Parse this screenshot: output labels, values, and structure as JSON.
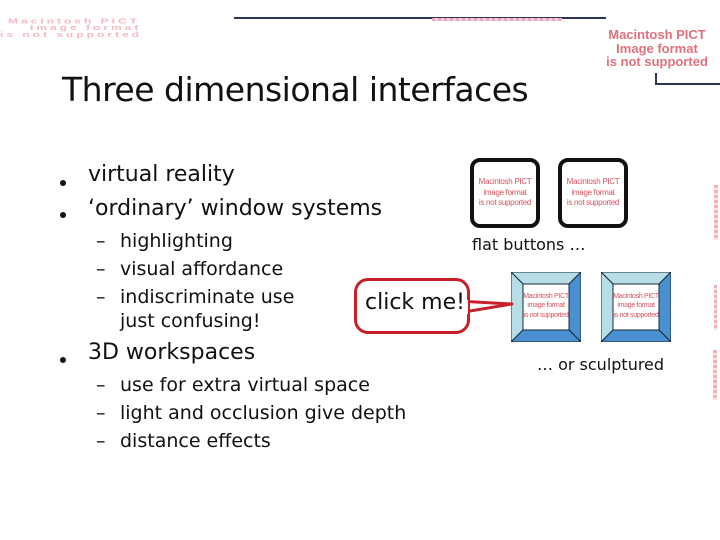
{
  "slide": {
    "title": "Three dimensional interfaces",
    "bullets": [
      {
        "text": "virtual reality"
      },
      {
        "text": "‘ordinary’ window systems",
        "subitems": [
          "highlighting",
          "visual affordance",
          "indiscriminate use",
          "just confusing!"
        ]
      },
      {
        "text": "3D workspaces",
        "subitems": [
          "use for extra virtual space",
          "light and occlusion give depth",
          "distance effects"
        ]
      }
    ],
    "dash": "–",
    "callout_text": "click me!",
    "flat_caption": "flat buttons …",
    "sculpt_caption": "… or sculptured"
  },
  "placeholders": {
    "line1": "Macintosh PICT",
    "line2": "Image format",
    "line3": "is not supported",
    "small_line1": "Macintosh PICT",
    "small_line2": "image format",
    "small_line3": "is not supported"
  },
  "colors": {
    "placeholder_text": "#e0707c",
    "callout_border": "#c8202a",
    "sculpt_light": "#b7dde6",
    "sculpt_dark": "#4a90d0",
    "rule": "#2e3552"
  }
}
